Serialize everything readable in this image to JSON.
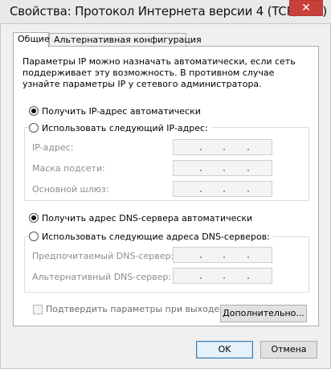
{
  "window": {
    "title": "Свойства: Протокол Интернета версии 4 (TCP/IPv4)",
    "close_glyph": "✕"
  },
  "tabs": [
    {
      "label": "Общие",
      "active": true
    },
    {
      "label": "Альтернативная конфигурация",
      "active": false
    }
  ],
  "description": "Параметры IP можно назначать автоматически, если сеть поддерживает эту возможность. В противном случае узнайте параметры IP у сетевого администратора.",
  "ip_section": {
    "auto_label": "Получить IP-адрес автоматически",
    "auto_checked": true,
    "manual_label": "Использовать следующий IP-адрес:",
    "manual_checked": false,
    "fields": [
      {
        "label": "IP-адрес:",
        "value": ". . ."
      },
      {
        "label": "Маска подсети:",
        "value": ". . ."
      },
      {
        "label": "Основной шлюз:",
        "value": ". . ."
      }
    ]
  },
  "dns_section": {
    "auto_label": "Получить адрес DNS-сервера автоматически",
    "auto_checked": true,
    "manual_label": "Использовать следующие адреса DNS-серверов:",
    "manual_checked": false,
    "fields": [
      {
        "label": "Предпочитаемый DNS-сервер:",
        "value": ". . ."
      },
      {
        "label": "Альтернативный DNS-сервер:",
        "value": ". . ."
      }
    ]
  },
  "validate_on_exit": {
    "label": "Подтвердить параметры при выходе",
    "checked": false,
    "enabled": false
  },
  "buttons": {
    "advanced": "Дополнительно...",
    "ok": "OK",
    "cancel": "Отмена"
  }
}
